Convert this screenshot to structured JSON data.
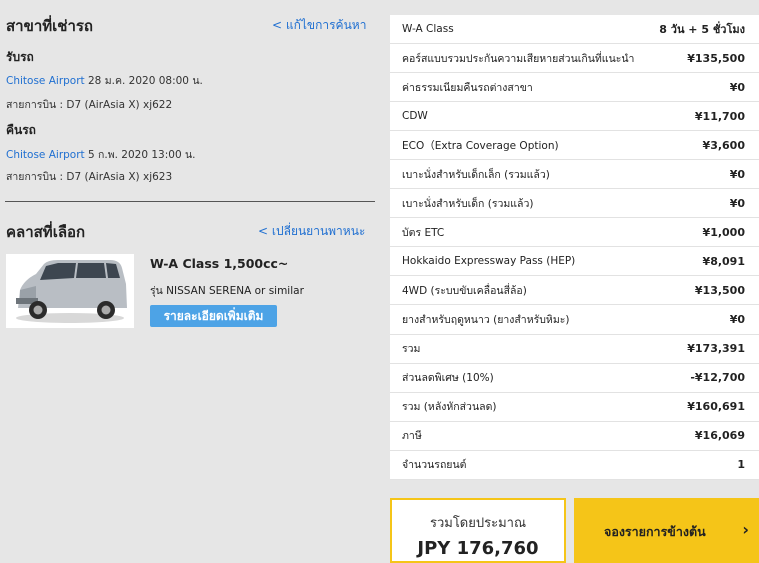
{
  "pickup_section": {
    "title": "สาขาที่เช่ารถ",
    "edit_link": "< แก้ไขการค้นหา",
    "pickup_heading": "รับรถ",
    "pickup_location": "Chitose Airport",
    "pickup_datetime": "28 ม.ค. 2020 08:00 น.",
    "pickup_flight": "สายการบิน : D7 (AirAsia X) xj622",
    "return_heading": "คืนรถ",
    "return_location": "Chitose Airport",
    "return_datetime": "5 ก.พ. 2020 13:00 น.",
    "return_flight": "สายการบิน : D7 (AirAsia X) xj623"
  },
  "class_section": {
    "title": "คลาสที่เลือก",
    "change_link": "< เปลี่ยนยานพาหนะ",
    "car_name": "W-A Class 1,500cc~",
    "car_model": "รุ่น NISSAN SERENA or similar",
    "detail_button": "รายละเอียดเพิ่มเติม"
  },
  "price_table": [
    {
      "label": "W-A Class",
      "value": "8 วัน + 5 ชั่วโมง"
    },
    {
      "label": "คอร์สแบบรวมประกันความเสียหายส่วนเกินที่แนะนำ",
      "value": "¥135,500"
    },
    {
      "label": "ค่าธรรมเนียมคืนรถต่างสาขา",
      "value": "¥0"
    },
    {
      "label": "CDW",
      "value": "¥11,700"
    },
    {
      "label": "ECO（Extra Coverage Option)",
      "value": "¥3,600"
    },
    {
      "label": "เบาะนั่งสำหรับเด็กเล็ก (รวมแล้ว)",
      "value": "¥0"
    },
    {
      "label": "เบาะนั่งสำหรับเด็ก (รวมแล้ว)",
      "value": "¥0"
    },
    {
      "label": "บัตร ETC",
      "value": "¥1,000"
    },
    {
      "label": "Hokkaido Expressway Pass (HEP)",
      "value": "¥8,091"
    },
    {
      "label": "4WD (ระบบขับเคลื่อนสี่ล้อ)",
      "value": "¥13,500"
    },
    {
      "label": "ยางสำหรับฤดูหนาว (ยางสำหรับหิมะ)",
      "value": "¥0"
    },
    {
      "label": "รวม",
      "value": "¥173,391"
    },
    {
      "label": "ส่วนลดพิเศษ (10%)",
      "value": "-¥12,700"
    },
    {
      "label": "รวม (หลังหักส่วนลด)",
      "value": "¥160,691"
    },
    {
      "label": "ภาษี",
      "value": "¥16,069"
    },
    {
      "label": "จำนวนรถยนต์",
      "value": "1"
    }
  ],
  "total": {
    "label": "รวมโดยประมาณ",
    "value": "JPY 176,760"
  },
  "reserve_button": {
    "label": "จองรายการข้างต้น",
    "arrow": "›"
  }
}
